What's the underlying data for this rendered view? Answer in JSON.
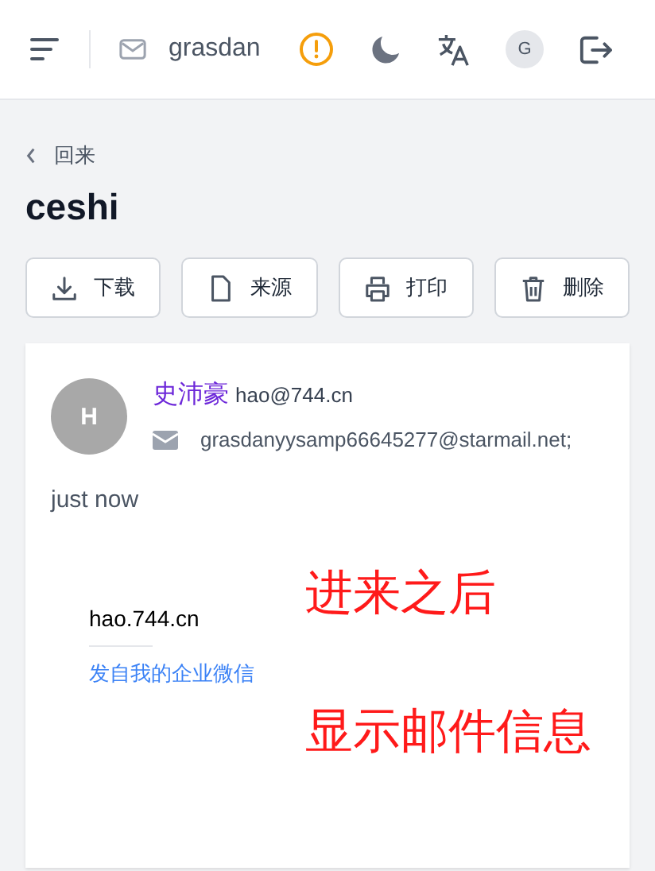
{
  "header": {
    "account": "grasdan",
    "avatar_letter": "G"
  },
  "back": "回来",
  "title": "ceshi",
  "actions": [
    {
      "kind": "download",
      "label": "下载"
    },
    {
      "kind": "source",
      "label": "来源"
    },
    {
      "kind": "print",
      "label": "打印"
    },
    {
      "kind": "delete",
      "label": "删除"
    }
  ],
  "message": {
    "avatar_letter": "H",
    "sender_name": "史沛豪",
    "sender_email": "hao@744.cn",
    "recipient": "grasdanyysamp66645277@starmail.net;",
    "time": "just now",
    "body": "hao.744.cn",
    "signature": "发自我的企业微信"
  },
  "annotations": [
    "进来之后",
    "显示邮件信息"
  ]
}
